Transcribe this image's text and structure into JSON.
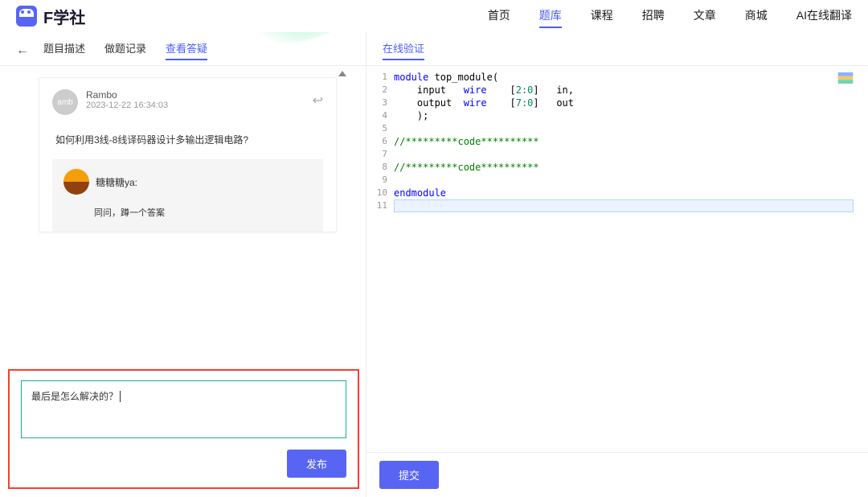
{
  "logo_text": "F学社",
  "nav": [
    {
      "label": "首页",
      "active": false
    },
    {
      "label": "题库",
      "active": true
    },
    {
      "label": "课程",
      "active": false
    },
    {
      "label": "招聘",
      "active": false
    },
    {
      "label": "文章",
      "active": false
    },
    {
      "label": "商城",
      "active": false
    },
    {
      "label": "AI在线翻译",
      "active": false
    }
  ],
  "left": {
    "tabs": [
      {
        "label": "题目描述",
        "active": false
      },
      {
        "label": "做题记录",
        "active": false
      },
      {
        "label": "查看答疑",
        "active": true
      }
    ],
    "post": {
      "author": "Rambo",
      "avatar_text": "amb",
      "time": "2023-12-22 16:34:03",
      "body": "如何利用3线-8线译码器设计多输出逻辑电路?"
    },
    "reply": {
      "author_label": "糖糖糖ya:",
      "body": "同问，蹲一个答案"
    },
    "compose": {
      "value": "最后是怎么解决的？",
      "publish_label": "发布"
    }
  },
  "right": {
    "tab_label": "在线验证",
    "submit_label": "提交",
    "code": [
      {
        "n": 1,
        "tokens": [
          {
            "t": "module ",
            "c": "kw"
          },
          {
            "t": "top_module(",
            "c": "ident"
          }
        ]
      },
      {
        "n": 2,
        "tokens": [
          {
            "t": "    input   ",
            "c": "ident"
          },
          {
            "t": "wire",
            "c": "kw"
          },
          {
            "t": "    [",
            "c": "ident"
          },
          {
            "t": "2:0",
            "c": "num"
          },
          {
            "t": "]   in,",
            "c": "ident"
          }
        ]
      },
      {
        "n": 3,
        "tokens": [
          {
            "t": "    output  ",
            "c": "ident"
          },
          {
            "t": "wire",
            "c": "kw"
          },
          {
            "t": "    [",
            "c": "ident"
          },
          {
            "t": "7:0",
            "c": "num"
          },
          {
            "t": "]   out",
            "c": "ident"
          }
        ]
      },
      {
        "n": 4,
        "tokens": [
          {
            "t": "    );",
            "c": "ident"
          }
        ]
      },
      {
        "n": 5,
        "tokens": []
      },
      {
        "n": 6,
        "tokens": [
          {
            "t": "//*********code**********",
            "c": "comment"
          }
        ]
      },
      {
        "n": 7,
        "tokens": []
      },
      {
        "n": 8,
        "tokens": [
          {
            "t": "//*********code**********",
            "c": "comment"
          }
        ]
      },
      {
        "n": 9,
        "tokens": []
      },
      {
        "n": 10,
        "tokens": [
          {
            "t": "endmodule",
            "c": "kw"
          }
        ]
      },
      {
        "n": 11,
        "tokens": [],
        "highlight": true
      }
    ]
  }
}
